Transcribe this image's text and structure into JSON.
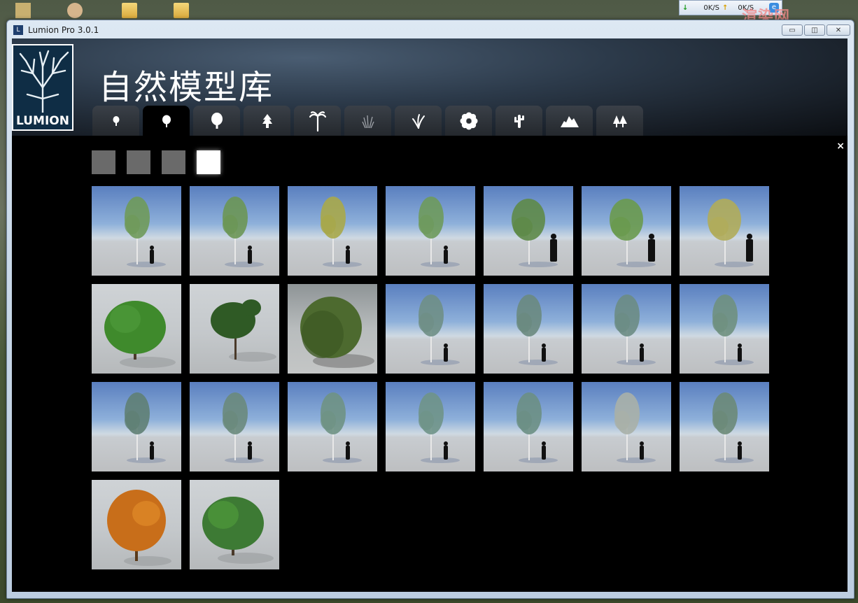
{
  "window": {
    "title": "Lumion Pro  3.0.1",
    "min_label": "▭",
    "max_label": "◫",
    "close_label": "✕"
  },
  "net_widget": {
    "down": "0K/S",
    "up": "0K/S"
  },
  "watermark": "渲染网",
  "logo": {
    "text": "LUMION"
  },
  "page_title": "自然模型库",
  "tabs": [
    {
      "icon": "small-tree-icon",
      "active": false
    },
    {
      "icon": "deciduous-tree-icon",
      "active": true
    },
    {
      "icon": "large-tree-icon",
      "active": false
    },
    {
      "icon": "conifer-icon",
      "active": false
    },
    {
      "icon": "palm-icon",
      "active": false
    },
    {
      "icon": "grass-icon",
      "active": false
    },
    {
      "icon": "plant-icon",
      "active": false
    },
    {
      "icon": "flower-icon",
      "active": false
    },
    {
      "icon": "cactus-icon",
      "active": false
    },
    {
      "icon": "rocks-icon",
      "active": false
    },
    {
      "icon": "forest-icon",
      "active": false
    }
  ],
  "close_symbol": "×",
  "size_options": [
    false,
    false,
    false,
    true
  ],
  "models": [
    {
      "bg": "sky",
      "kind": "birch",
      "color": "#6f9a5a",
      "person": true
    },
    {
      "bg": "sky",
      "kind": "birch",
      "color": "#6c9655",
      "person": true
    },
    {
      "bg": "sky",
      "kind": "birch",
      "color": "#a8a84a",
      "person": true
    },
    {
      "bg": "sky",
      "kind": "birch",
      "color": "#6e9a5c",
      "person": true
    },
    {
      "bg": "sky",
      "kind": "round",
      "color": "#5e8a48",
      "person": true
    },
    {
      "bg": "sky",
      "kind": "round",
      "color": "#6a9a4e",
      "person": true
    },
    {
      "bg": "sky",
      "kind": "round",
      "color": "#b0ac5a",
      "person": true
    },
    {
      "bg": "light",
      "kind": "bush",
      "color": "#3f8a2c",
      "person": false
    },
    {
      "bg": "light",
      "kind": "spread",
      "color": "#2f5a25",
      "person": false
    },
    {
      "bg": "fog",
      "kind": "willow",
      "color": "#4d6a2f",
      "person": false
    },
    {
      "bg": "sky",
      "kind": "birch",
      "color": "#6f8f86",
      "person": true
    },
    {
      "bg": "sky",
      "kind": "birch",
      "color": "#6a8a80",
      "person": true
    },
    {
      "bg": "sky",
      "kind": "birch",
      "color": "#6c8c84",
      "person": true
    },
    {
      "bg": "sky",
      "kind": "birch",
      "color": "#6f9080",
      "person": true
    },
    {
      "bg": "sky",
      "kind": "birch",
      "color": "#5f8074",
      "person": true
    },
    {
      "bg": "sky",
      "kind": "birch",
      "color": "#6a8a7c",
      "person": true
    },
    {
      "bg": "sky",
      "kind": "birch",
      "color": "#6f9284",
      "person": true
    },
    {
      "bg": "sky",
      "kind": "birch",
      "color": "#6f9488",
      "person": true
    },
    {
      "bg": "sky",
      "kind": "birch",
      "color": "#6c8f84",
      "person": true
    },
    {
      "bg": "sky",
      "kind": "birch",
      "color": "#a9b0a8",
      "person": true
    },
    {
      "bg": "sky",
      "kind": "birch",
      "color": "#6c8a78",
      "person": true
    },
    {
      "bg": "light",
      "kind": "maple",
      "color": "#c86e1a",
      "person": false
    },
    {
      "bg": "light",
      "kind": "bush",
      "color": "#3d7a34",
      "person": false
    }
  ]
}
